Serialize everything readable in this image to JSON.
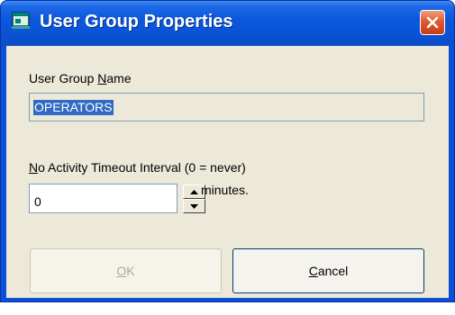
{
  "window": {
    "title": "User Group Properties"
  },
  "group_name": {
    "label_prefix": "User Group ",
    "label_mnemonic": "N",
    "label_suffix": "ame",
    "value": "OPERATORS"
  },
  "timeout": {
    "label_mnemonic": "N",
    "label_rest": "o Activity Timeout Interval (0 = never)",
    "value": "0",
    "unit": "minutes."
  },
  "buttons": {
    "ok_mnemonic": "O",
    "ok_rest": "K",
    "cancel_mnemonic": "C",
    "cancel_rest": "ancel"
  },
  "colors": {
    "titlebar": "#0a52d4",
    "client": "#ece9d8",
    "selection": "#316ac5",
    "close": "#c63d14"
  }
}
